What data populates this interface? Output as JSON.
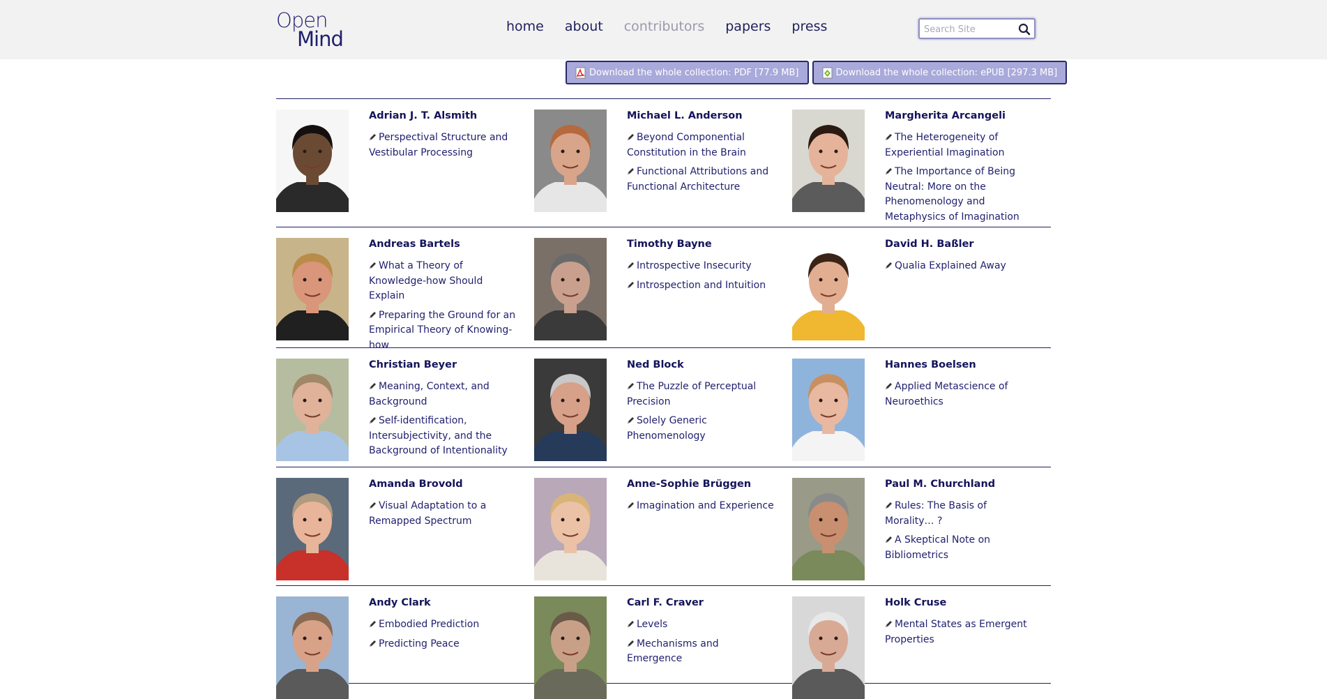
{
  "logo": {
    "line1": "Open",
    "line2": "Mind"
  },
  "nav": [
    {
      "label": "home",
      "active": false
    },
    {
      "label": "about",
      "active": false
    },
    {
      "label": "contributors",
      "active": true
    },
    {
      "label": "papers",
      "active": false
    },
    {
      "label": "press",
      "active": false
    }
  ],
  "search": {
    "placeholder": "Search Site"
  },
  "downloads": {
    "pdf_label": "Download the whole collection: PDF [77.9 MB]",
    "epub_label": "Download the whole collection: ePUB [297.3 MB]"
  },
  "contributors": [
    {
      "name": "Adrian J. T. Alsmith",
      "papers": [
        "Perspectival Structure and Vestibular Processing"
      ],
      "skin": "#6b4a34",
      "hair": "#141010",
      "shirt": "#2a2a2a",
      "bg": "#f6f6f6"
    },
    {
      "name": "Michael L. Anderson",
      "papers": [
        "Beyond Componential Constitution in the Brain",
        "Functional Attributions and Functional Architecture"
      ],
      "skin": "#d9a58a",
      "hair": "#b56a3e",
      "shirt": "#e6e6e6",
      "bg": "#8a8a8a"
    },
    {
      "name": "Margherita Arcangeli",
      "papers": [
        "The Heterogeneity of Experiential Imagination",
        "The Importance of Being Neutral: More on the Phenomenology and Metaphysics of Imagination"
      ],
      "skin": "#e4b39a",
      "hair": "#2b1a12",
      "shirt": "#5b5b5b",
      "bg": "#d8d8d0"
    },
    {
      "name": "Andreas Bartels",
      "papers": [
        "What a Theory of Knowledge-how Should Explain",
        "Preparing the Ground for an Empirical Theory of Knowing-how"
      ],
      "skin": "#d9967a",
      "hair": "#b98c4a",
      "shirt": "#202020",
      "bg": "#c8b48a"
    },
    {
      "name": "Timothy Bayne",
      "papers": [
        "Introspective Insecurity",
        "Introspection and Intuition"
      ],
      "skin": "#c9a08e",
      "hair": "#6a6a6a",
      "shirt": "#3a3a3a",
      "bg": "#7a7068"
    },
    {
      "name": "David H. Baßler",
      "papers": [
        "Qualia Explained Away"
      ],
      "skin": "#e2ae92",
      "hair": "#3a2416",
      "shirt": "#f0b830",
      "bg": "#ffffff"
    },
    {
      "name": "Christian Beyer",
      "papers": [
        "Meaning, Context, and Background",
        "Self-identification, Intersubjectivity, and the Background of Intentionality"
      ],
      "skin": "#e0b29a",
      "hair": "#a08868",
      "shirt": "#a8c4e4",
      "bg": "#b6bca0"
    },
    {
      "name": "Ned Block",
      "papers": [
        "The Puzzle of Perceptual Precision",
        "Solely Generic Phenomenology"
      ],
      "skin": "#d7a088",
      "hair": "#c8c8c8",
      "shirt": "#263a5a",
      "bg": "#3a3a3a"
    },
    {
      "name": "Hannes Boelsen",
      "papers": [
        "Applied Metascience of Neuroethics"
      ],
      "skin": "#e8b8a0",
      "hair": "#c89060",
      "shirt": "#f4f4f4",
      "bg": "#8fb4dc"
    },
    {
      "name": "Amanda Brovold",
      "papers": [
        "Visual Adaptation to a Remapped Spectrum"
      ],
      "skin": "#e8b49a",
      "hair": "#b09a80",
      "shirt": "#c8302a",
      "bg": "#5a6a7a"
    },
    {
      "name": "Anne-Sophie Brüggen",
      "papers": [
        "Imagination and Experience"
      ],
      "skin": "#ecc2a6",
      "hair": "#d8b478",
      "shirt": "#e8e4dc",
      "bg": "#b8a8b8"
    },
    {
      "name": "Paul M. Churchland",
      "papers": [
        "Rules: The Basis of Morality… ?",
        "A Skeptical Note on Bibliometrics"
      ],
      "skin": "#c89070",
      "hair": "#8a8a8a",
      "shirt": "#7a8a5a",
      "bg": "#9a9a88"
    },
    {
      "name": "Andy Clark",
      "papers": [
        "Embodied Prediction",
        "Predicting Peace"
      ],
      "skin": "#d8a288",
      "hair": "#8a6a52",
      "shirt": "#5a5a5a",
      "bg": "#9ab4d4"
    },
    {
      "name": "Carl F. Craver",
      "papers": [
        "Levels",
        "Mechanisms and Emergence"
      ],
      "skin": "#c8a088",
      "hair": "#6a5a48",
      "shirt": "#6a6a5a",
      "bg": "#7a8a5a"
    },
    {
      "name": "Holk Cruse",
      "papers": [
        "Mental States as Emergent Properties"
      ],
      "skin": "#d8aa96",
      "hair": "#e8e8e8",
      "shirt": "#5a5a5a",
      "bg": "#d8d8d8"
    }
  ]
}
